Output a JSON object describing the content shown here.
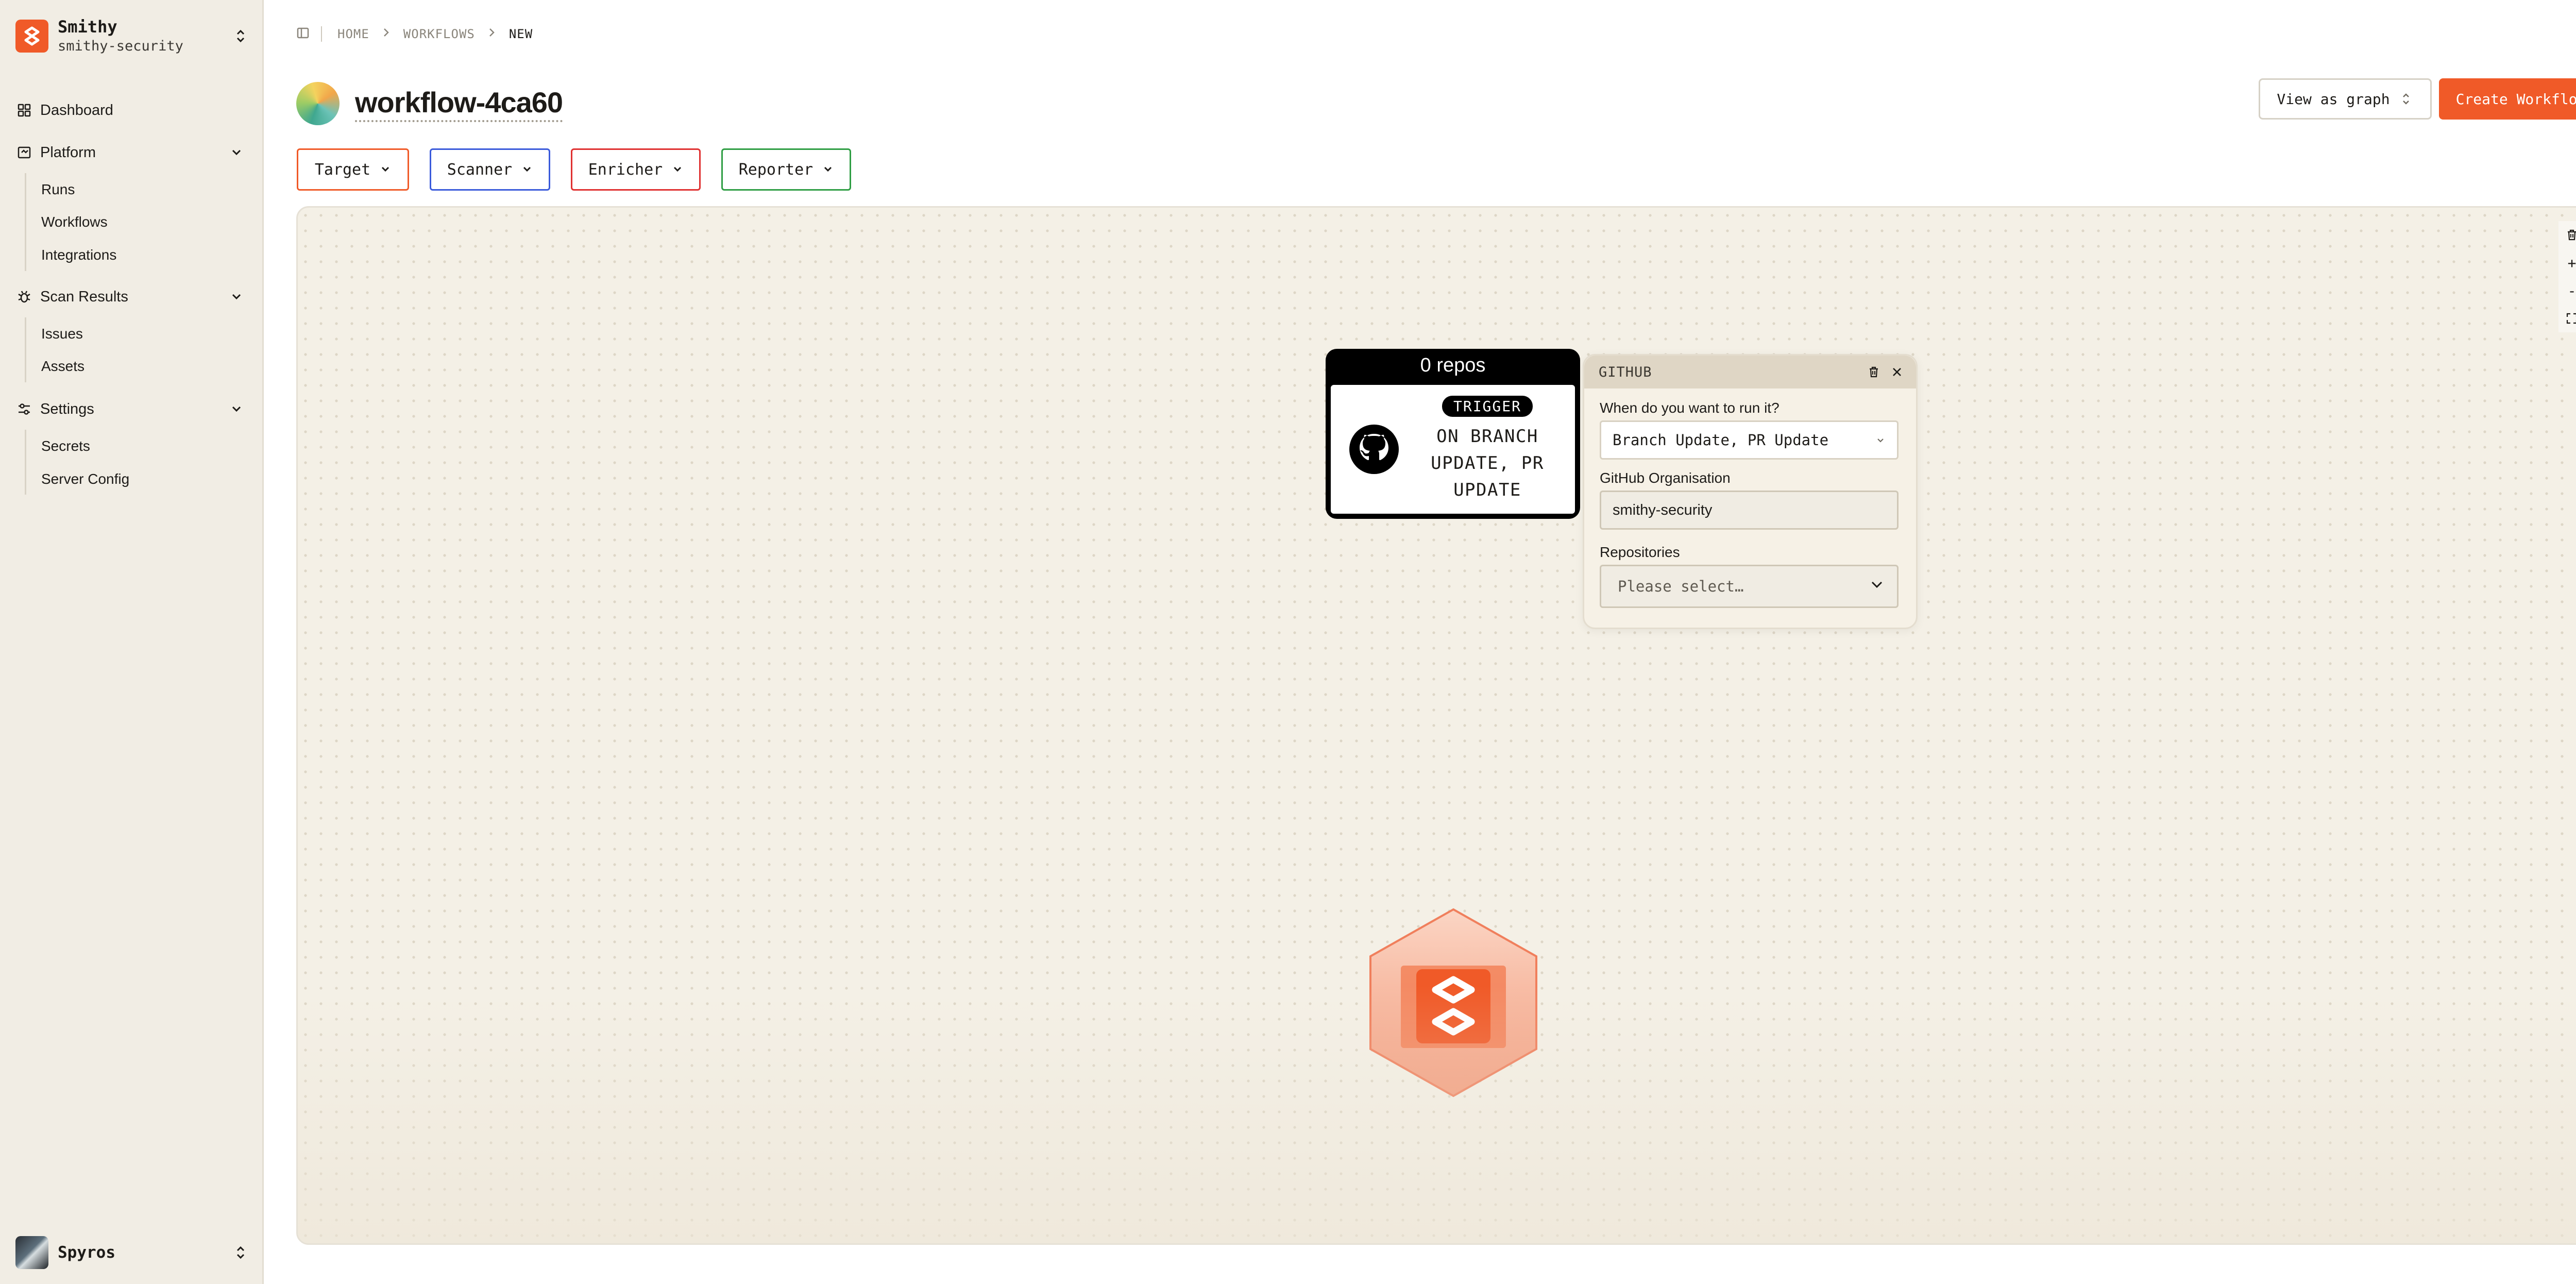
{
  "sidebar": {
    "org": {
      "name": "Smithy",
      "slug": "smithy-security"
    },
    "items": [
      {
        "label": "Dashboard"
      },
      {
        "label": "Platform",
        "children": [
          "Runs",
          "Workflows",
          "Integrations"
        ]
      },
      {
        "label": "Scan Results",
        "children": [
          "Issues",
          "Assets"
        ]
      },
      {
        "label": "Settings",
        "children": [
          "Secrets",
          "Server Config"
        ]
      }
    ],
    "user": {
      "name": "Spyros"
    }
  },
  "breadcrumb": [
    "HOME",
    "WORKFLOWS",
    "NEW"
  ],
  "page": {
    "title": "workflow-4ca60",
    "view_button": "View as graph",
    "create_button": "Create Workflow"
  },
  "filters": [
    {
      "label": "Target",
      "color": "#f05a28"
    },
    {
      "label": "Scanner",
      "color": "#3b5bdb"
    },
    {
      "label": "Enricher",
      "color": "#e03131"
    },
    {
      "label": "Reporter",
      "color": "#2f9e44"
    }
  ],
  "canvas_controls": [
    "trash-icon",
    "+",
    "-",
    "fit-view-icon"
  ],
  "node": {
    "header": "0 repos",
    "badge": "TRIGGER",
    "trigger_lines": [
      "ON BRANCH",
      "UPDATE, PR",
      "UPDATE"
    ]
  },
  "panel": {
    "title": "GITHUB",
    "run_label": "When do you want to run it?",
    "run_value": "Branch Update, PR Update",
    "org_label": "GitHub Organisation",
    "org_value": "smithy-security",
    "repos_label": "Repositories",
    "repos_placeholder": "Please select…"
  },
  "colors": {
    "accent": "#f05a28",
    "sidebar_bg": "#f1ede4",
    "canvas_bg": "#f4f0e6"
  }
}
